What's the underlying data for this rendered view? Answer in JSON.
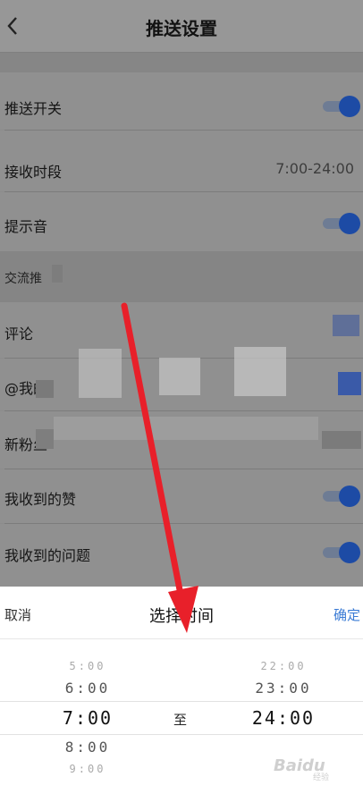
{
  "header": {
    "title": "推送设置"
  },
  "rows": {
    "push_switch": {
      "label": "推送开关"
    },
    "receive_period": {
      "label": "接收时段",
      "value": "7:00-24:00"
    },
    "sound": {
      "label": "提示音"
    },
    "section": {
      "label": "交流推"
    },
    "comment": {
      "label": "评论"
    },
    "at_me": {
      "label": "@我的"
    },
    "new_fans": {
      "label": "新粉丝"
    },
    "likes": {
      "label": "我收到的赞"
    },
    "questions": {
      "label": "我收到的问题"
    }
  },
  "sheet": {
    "cancel": "取消",
    "title": "选择时间",
    "confirm": "确定",
    "to": "至",
    "start_column": [
      "5:00",
      "6:00",
      "7:00",
      "8:00",
      "9:00"
    ],
    "end_column": [
      "22:00",
      "23:00",
      "24:00"
    ]
  },
  "watermark": {
    "text": "Baidu",
    "sub": "经验"
  },
  "colors": {
    "toggle_on": "#1d4ba5",
    "confirm": "#3a7bd5",
    "arrow": "#e8202a"
  }
}
